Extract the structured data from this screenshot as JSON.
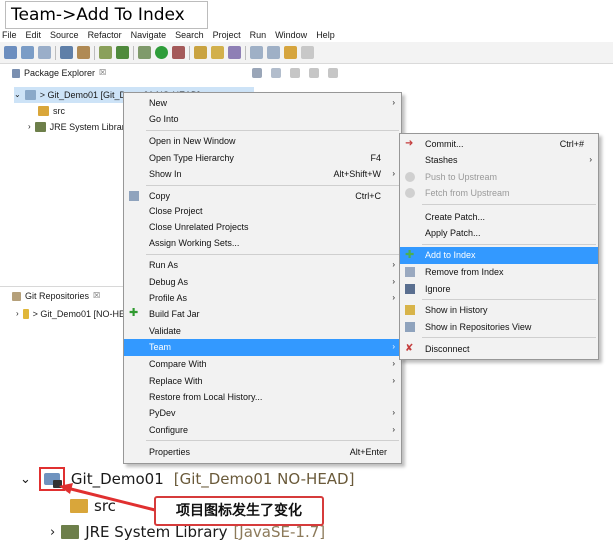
{
  "caption": "Team->Add To Index",
  "menubar": [
    "File",
    "Edit",
    "Source",
    "Refactor",
    "Navigate",
    "Search",
    "Project",
    "Run",
    "Window",
    "Help"
  ],
  "package_explorer": {
    "tab_label": "Package Explorer",
    "close_glyph": "☒",
    "project": "> Git_Demo01 [Git_Demo01 NO-HEAD]",
    "src": "src",
    "jre": "JRE System Library"
  },
  "git_repositories": {
    "tab_label": "Git Repositories",
    "close_glyph": "☒",
    "repo": "> Git_Demo01 [NO-HEAD]"
  },
  "context_menu": {
    "items": [
      {
        "label": "New",
        "submenu": true
      },
      {
        "label": "Go Into"
      },
      {
        "label": "Open in New Window"
      },
      {
        "label": "Open Type Hierarchy",
        "accel": "F4"
      },
      {
        "label": "Show In",
        "accel": "Alt+Shift+W",
        "submenu": true
      },
      {
        "label": "Copy",
        "accel": "Ctrl+C"
      },
      {
        "label": "Close Project"
      },
      {
        "label": "Close Unrelated Projects"
      },
      {
        "label": "Assign Working Sets..."
      },
      {
        "label": "Run As",
        "submenu": true
      },
      {
        "label": "Debug As",
        "submenu": true
      },
      {
        "label": "Profile As",
        "submenu": true
      },
      {
        "label": "Build Fat Jar"
      },
      {
        "label": "Validate"
      },
      {
        "label": "Team",
        "submenu": true
      },
      {
        "label": "Compare With",
        "submenu": true
      },
      {
        "label": "Replace With",
        "submenu": true
      },
      {
        "label": "Restore from Local History..."
      },
      {
        "label": "PyDev",
        "submenu": true
      },
      {
        "label": "Configure",
        "submenu": true
      },
      {
        "label": "Properties",
        "accel": "Alt+Enter"
      }
    ]
  },
  "team_menu": {
    "items": [
      {
        "label": "Commit...",
        "accel": "Ctrl+#"
      },
      {
        "label": "Stashes",
        "submenu": true
      },
      {
        "label": "Push to Upstream"
      },
      {
        "label": "Fetch from Upstream"
      },
      {
        "label": "Create Patch..."
      },
      {
        "label": "Apply Patch..."
      },
      {
        "label": "Add to Index"
      },
      {
        "label": "Remove from Index"
      },
      {
        "label": "Ignore"
      },
      {
        "label": "Show in History"
      },
      {
        "label": "Show in Repositories View"
      },
      {
        "label": "Disconnect"
      }
    ]
  },
  "zoom": {
    "project_name": "Git_Demo01",
    "project_branch": "[Git_Demo01 NO-HEAD]",
    "src": "src",
    "jre_name": "JRE System Library",
    "jre_version": "[JavaSE-1.7]",
    "callout": "项目图标发生了变化"
  },
  "colors": {
    "highlight": "#3399ff",
    "callout_border": "#d63b3b",
    "annotation_red": "#e03030"
  }
}
